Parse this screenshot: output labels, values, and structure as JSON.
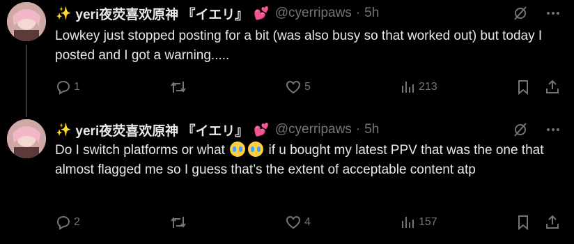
{
  "tweets": [
    {
      "author_prefix_emoji": "✨",
      "display_name": "yeri夜荧喜欢原神 『イエリ』",
      "name_suffix_emoji": "💕",
      "handle": "@cyerripaws",
      "separator": "·",
      "time": "5h",
      "text": "Lowkey just stopped posting for a bit (was also busy so that worked out) but today I posted and I got a warning.....",
      "replies": "1",
      "retweets": "",
      "likes": "5",
      "views": "213"
    },
    {
      "author_prefix_emoji": "✨",
      "display_name": "yeri夜荧喜欢原神 『イエリ』",
      "name_suffix_emoji": "💕",
      "handle": "@cyerripaws",
      "separator": "·",
      "time": "5h",
      "text_part1": "Do I switch platforms or what",
      "text_part2": "if u bought my latest PPV that was the one that almost flagged me so I guess that’s the extent of acceptable content atp",
      "replies": "2",
      "retweets": "",
      "likes": "4",
      "views": "157"
    }
  ],
  "icons": {
    "grok": "grok-icon",
    "more": "more-icon",
    "reply": "reply-icon",
    "retweet": "retweet-icon",
    "like": "like-icon",
    "views": "views-icon",
    "bookmark": "bookmark-icon",
    "share": "share-icon"
  },
  "colors": {
    "background": "#000000",
    "text": "#e7e9ea",
    "secondary": "#71767b",
    "thread_line": "#333639"
  }
}
